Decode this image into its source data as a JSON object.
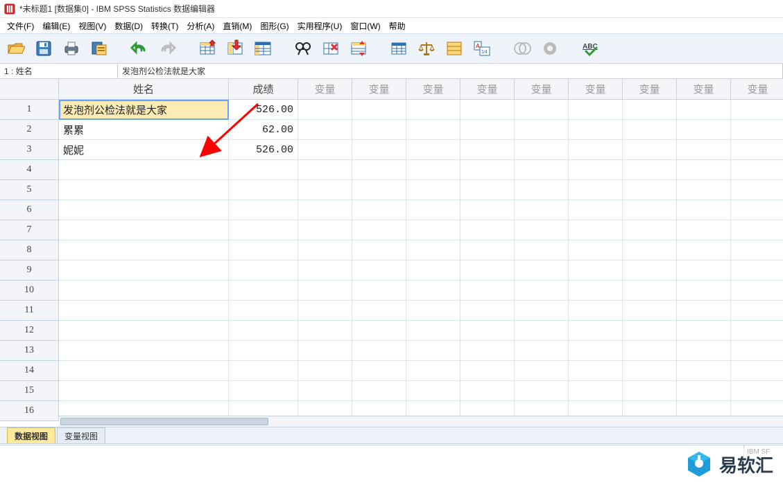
{
  "window": {
    "title": "*未标题1 [数据集0] - IBM SPSS Statistics 数据编辑器"
  },
  "menu": {
    "items": [
      {
        "label": "文件(F)"
      },
      {
        "label": "编辑(E)"
      },
      {
        "label": "视图(V)"
      },
      {
        "label": "数据(D)"
      },
      {
        "label": "转换(T)"
      },
      {
        "label": "分析(A)"
      },
      {
        "label": "直销(M)"
      },
      {
        "label": "图形(G)"
      },
      {
        "label": "实用程序(U)"
      },
      {
        "label": "窗口(W)"
      },
      {
        "label": "帮助"
      }
    ]
  },
  "toolbar": {
    "icons": [
      "open-folder-icon",
      "save-icon",
      "print-icon",
      "recall-dialog-icon",
      "undo-icon",
      "redo-icon",
      "goto-case-icon",
      "goto-variable-icon",
      "variables-icon",
      "find-icon",
      "clear-icon",
      "split-file-icon",
      "weight-cases-icon",
      "select-cases-icon",
      "value-labels-icon",
      "use-sets-icon",
      "show-all-icon",
      "circle1-icon",
      "circle2-icon",
      "spellcheck-icon"
    ]
  },
  "namebar": {
    "cell_ref": "1 : 姓名",
    "cell_value": "发泡剂公检法就是大家"
  },
  "columns": {
    "name": "姓名",
    "score": "成绩",
    "var": "变量"
  },
  "rows": [
    {
      "n": "1",
      "name": "发泡剂公检法就是大家",
      "score": "526.00"
    },
    {
      "n": "2",
      "name": "累累",
      "score": "62.00"
    },
    {
      "n": "3",
      "name": "妮妮",
      "score": "526.00"
    },
    {
      "n": "4"
    },
    {
      "n": "5"
    },
    {
      "n": "6"
    },
    {
      "n": "7"
    },
    {
      "n": "8"
    },
    {
      "n": "9"
    },
    {
      "n": "10"
    },
    {
      "n": "11"
    },
    {
      "n": "12"
    },
    {
      "n": "13"
    },
    {
      "n": "14"
    },
    {
      "n": "15"
    },
    {
      "n": "16"
    }
  ],
  "tabs": {
    "data_view": "数据视图",
    "variable_view": "变量视图"
  },
  "status": {
    "right": "IBM SF"
  },
  "watermark": {
    "text": "易软汇"
  }
}
